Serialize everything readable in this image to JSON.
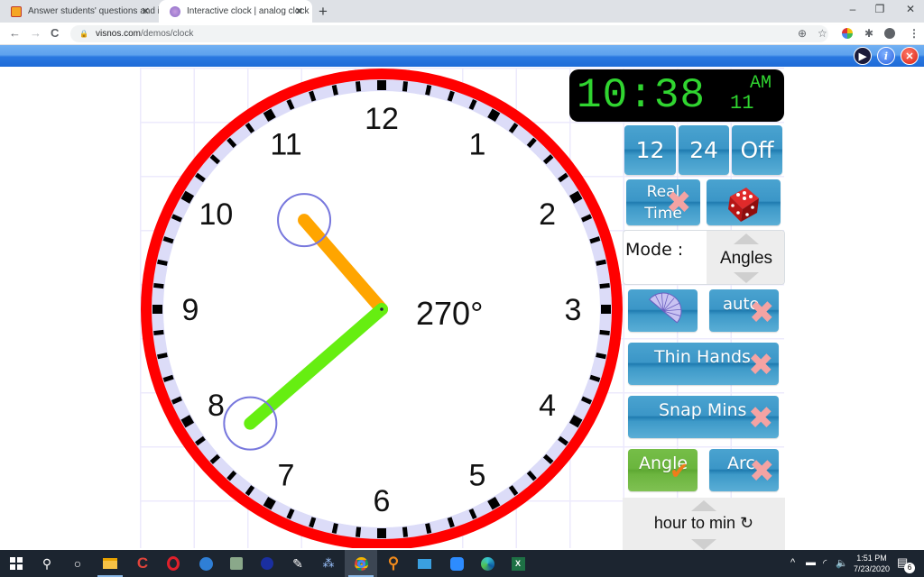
{
  "browser": {
    "tabs": [
      {
        "title": "Answer students' questions and i",
        "favicon": "classroom-icon",
        "active": false
      },
      {
        "title": "Interactive clock | analog clock | c",
        "favicon": "visnos-icon",
        "active": true
      }
    ],
    "new_tab_label": "+",
    "close_label": "✕",
    "window_controls": {
      "minimize": "–",
      "restore": "❐",
      "close": "✕"
    },
    "url": {
      "domain": "visnos.com",
      "path": "/demos/clock"
    },
    "nav": {
      "back": "←",
      "forward": "→",
      "reload": "C"
    }
  },
  "app_bar": {
    "buttons": [
      {
        "name": "video",
        "glyph": "▶"
      },
      {
        "name": "info",
        "glyph": "i"
      },
      {
        "name": "close",
        "glyph": "✕"
      }
    ]
  },
  "clock": {
    "numbers": [
      "12",
      "1",
      "2",
      "3",
      "4",
      "5",
      "6",
      "7",
      "8",
      "9",
      "10",
      "11"
    ],
    "hour_hand_angle_deg": 319,
    "minute_hand_angle_deg": 229,
    "angle_label": "270°",
    "colors": {
      "ring": "#ff0000",
      "band": "#dcdcf8",
      "hour_hand": "#ffa500",
      "minute_hand": "#66ee11",
      "handle_circle": "#7777dd"
    }
  },
  "digital": {
    "time": "10:38",
    "seconds": "11",
    "ampm": "AM"
  },
  "controls": {
    "format_buttons": [
      "12",
      "24",
      "Off"
    ],
    "real_time": {
      "line1": "Real",
      "line2": "Time",
      "state": "off"
    },
    "random_label": "random-dice",
    "mode": {
      "label": "Mode :",
      "value": "Angles"
    },
    "protractor_label": "protractor",
    "auto": {
      "label": "auto",
      "state": "off"
    },
    "thin_hands": {
      "label": "Thin Hands",
      "state": "off"
    },
    "snap_mins": {
      "label": "Snap Mins",
      "state": "off"
    },
    "angle": {
      "label": "Angle",
      "state": "on"
    },
    "arc": {
      "label": "Arc",
      "state": "off"
    },
    "direction": {
      "label": "hour to min ↻"
    }
  },
  "taskbar": {
    "apps": [
      "start",
      "search",
      "task-view",
      "file-explorer",
      "ccleaner",
      "opera",
      "mail",
      "app-shield",
      "app-blue",
      "app-feather",
      "app-dots",
      "chrome",
      "search-orange",
      "app-tiles",
      "zoom",
      "edge",
      "excel"
    ],
    "time": "1:51 PM",
    "date": "7/23/2020",
    "notifications": "6"
  }
}
